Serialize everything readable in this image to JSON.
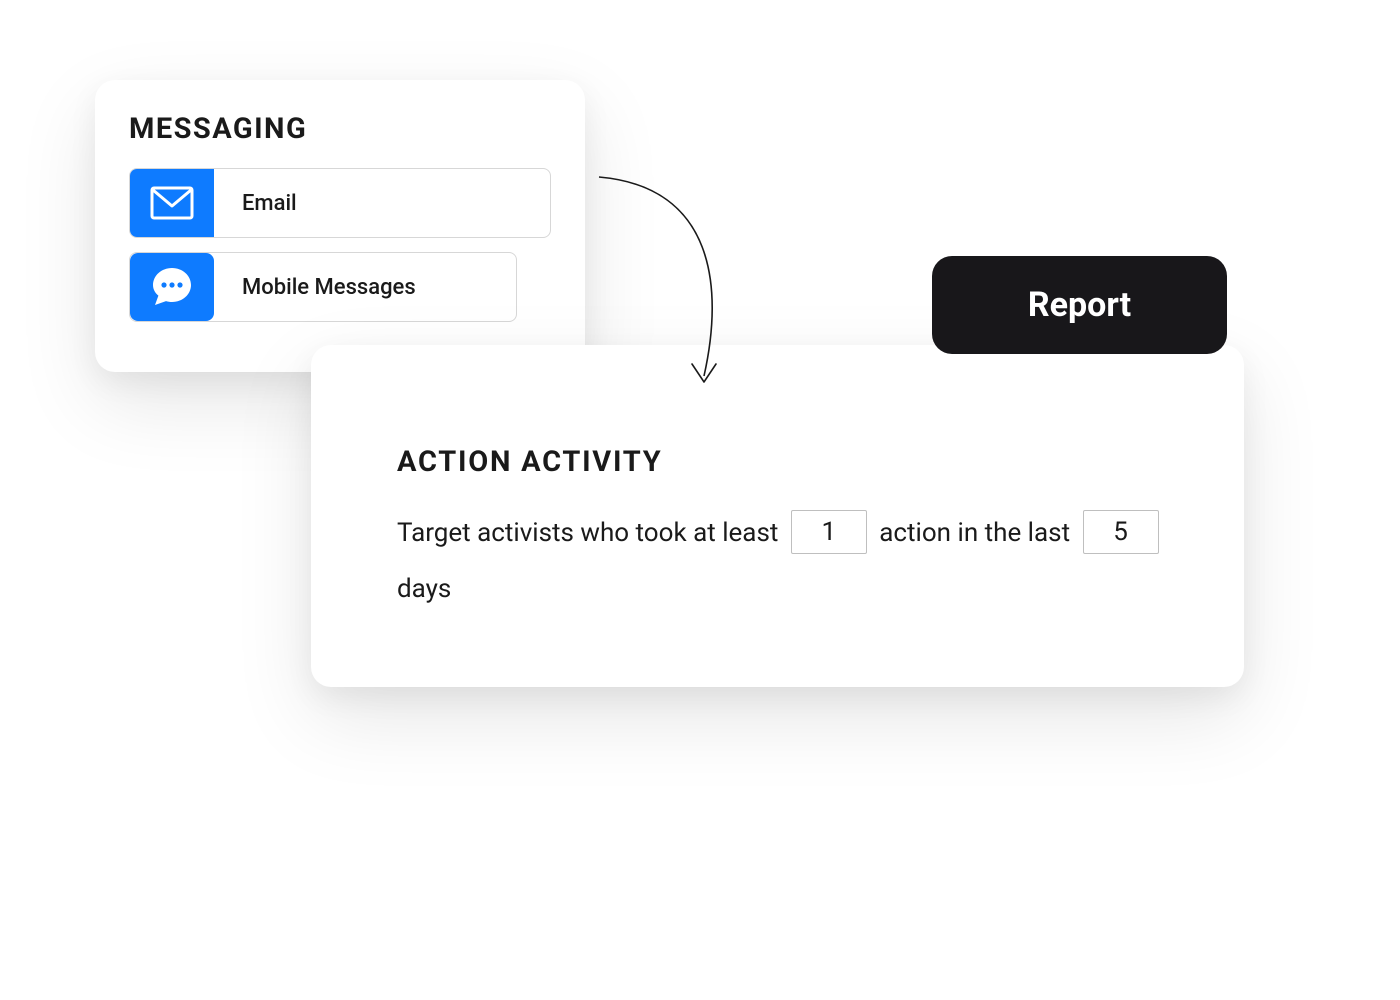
{
  "messaging": {
    "title": "MESSAGING",
    "options": [
      {
        "icon": "email-icon",
        "label": "Email"
      },
      {
        "icon": "chat-icon",
        "label": "Mobile Messages"
      }
    ]
  },
  "activity": {
    "title": "ACTION ACTIVITY",
    "text_parts": {
      "p1": "Target activists who took at least ",
      "p2": " action in the last ",
      "p3": " days"
    },
    "action_count": "1",
    "days_count": "5"
  },
  "report_button": {
    "label": "Report"
  },
  "colors": {
    "accent": "#0e7bff",
    "dark": "#18171a"
  }
}
